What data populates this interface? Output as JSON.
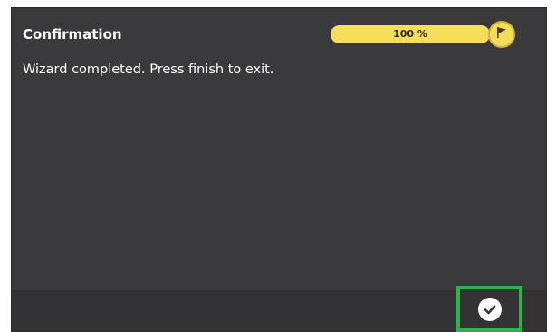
{
  "dialog": {
    "title": "Confirmation",
    "message": "Wizard completed. Press finish to exit."
  },
  "progress": {
    "percent": 100,
    "label": "100 %",
    "color": "#f3dd59",
    "end_icon": "flag-icon"
  },
  "footer": {
    "finish_icon": "check-icon",
    "highlight_color": "#2db34a"
  }
}
